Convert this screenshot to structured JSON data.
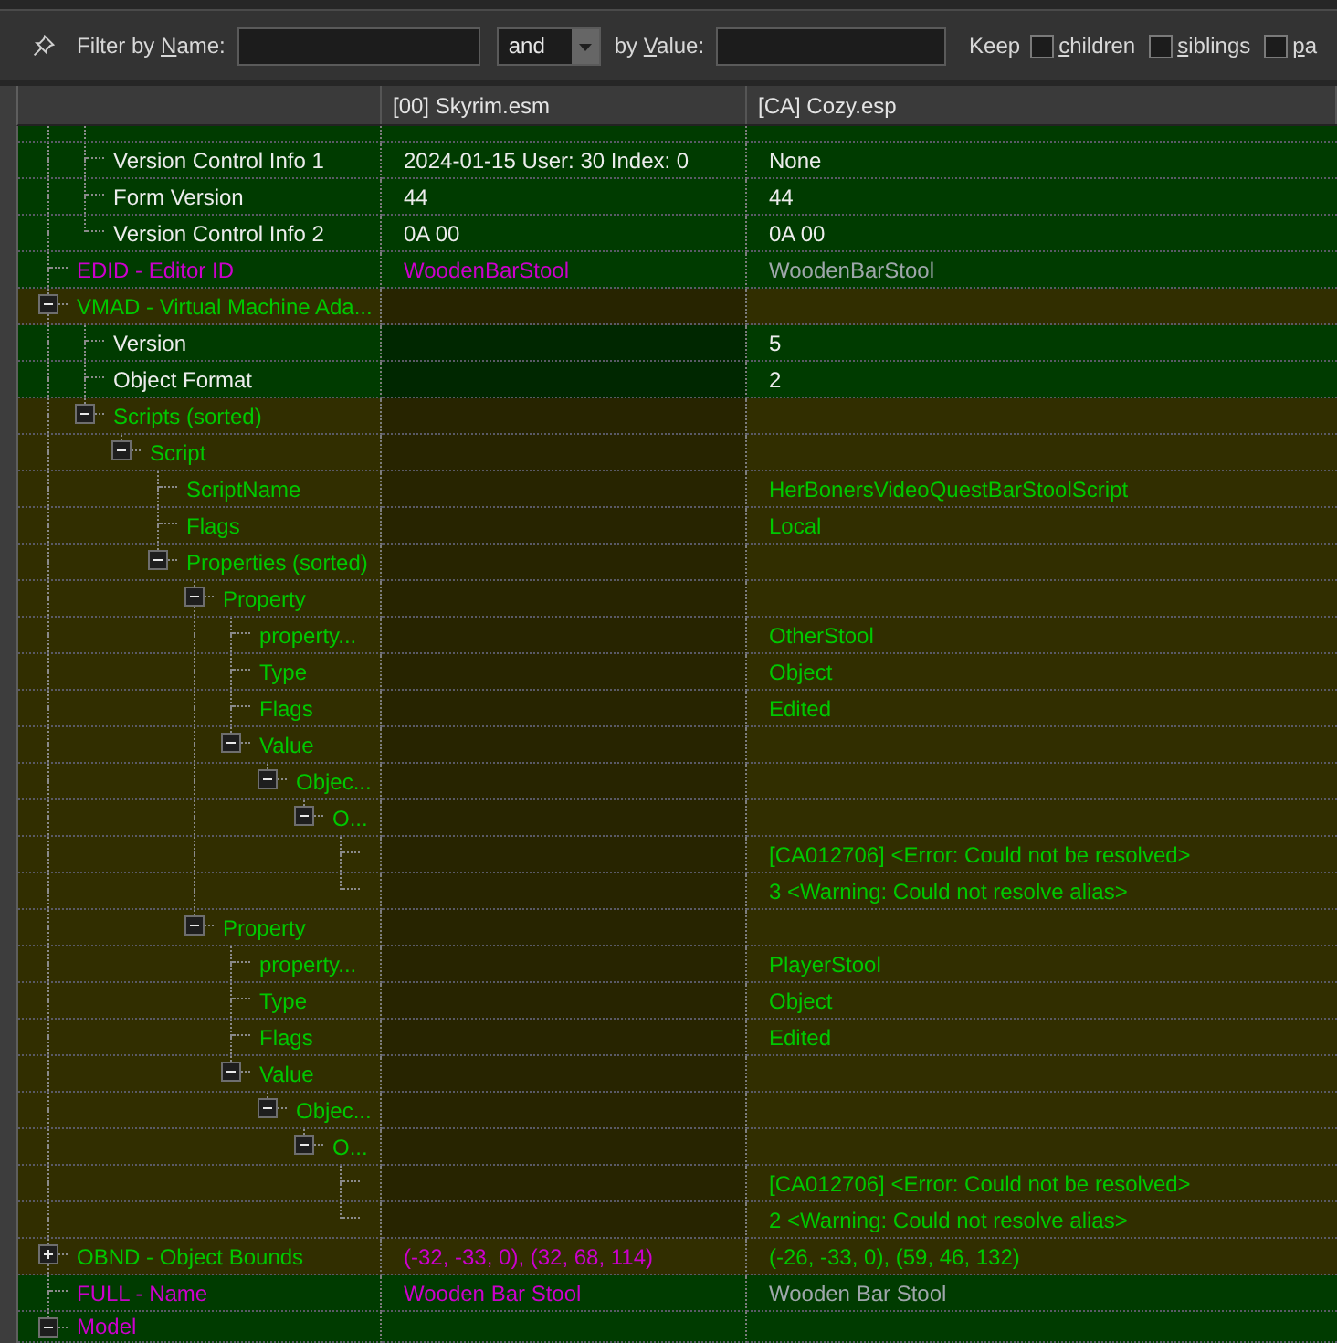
{
  "toolbar": {
    "name_filter": {
      "label": {
        "before": "Filter by ",
        "accel": "N",
        "after": "ame:"
      }
    },
    "operator": {
      "value": "and"
    },
    "value_filter": {
      "label": {
        "before": "by ",
        "accel": "V",
        "after": "alue:"
      }
    },
    "keep": {
      "label": "Keep",
      "options": [
        {
          "label": {
            "accel": "c",
            "after": "hildren"
          },
          "checked": false
        },
        {
          "label": {
            "accel": "s",
            "after": "iblings"
          },
          "checked": false
        },
        {
          "label": {
            "accel": "p",
            "after": "a"
          },
          "checked": false
        }
      ]
    }
  },
  "columns": [
    "[00] Skyrim.esm",
    "[CA] Cozy.esp"
  ],
  "tree": [
    {
      "children": [
        {
          "name": "Version Control Info 1",
          "color": "#ececec",
          "kind": "match",
          "cells": [
            {
              "defined": true,
              "text": "2024-01-15 User: 30 Index: 0",
              "color": "#ececec"
            },
            {
              "defined": true,
              "text": "None",
              "color": "#ececec"
            }
          ]
        },
        {
          "name": "Form Version",
          "color": "#ececec",
          "kind": "match",
          "cells": [
            {
              "defined": true,
              "text": "44",
              "color": "#ececec"
            },
            {
              "defined": true,
              "text": "44",
              "color": "#ececec"
            }
          ]
        },
        {
          "name": "Version Control Info 2",
          "color": "#ececec",
          "kind": "match",
          "cells": [
            {
              "defined": true,
              "text": "0A 00",
              "color": "#ececec"
            },
            {
              "defined": true,
              "text": "0A 00",
              "color": "#ececec"
            }
          ]
        }
      ]
    },
    {
      "name": "EDID - Editor ID",
      "color": "#cc00cc",
      "kind": "match",
      "cells": [
        {
          "defined": true,
          "text": "WoodenBarStool",
          "color": "#cc00cc"
        },
        {
          "defined": true,
          "text": "WoodenBarStool",
          "color": "#9fa7ab"
        }
      ]
    },
    {
      "name": "VMAD - Virtual Machine Ada...",
      "color": "#00c800",
      "kind": "override",
      "expanded": true,
      "cells": [
        {
          "defined": false
        },
        {
          "defined": true
        }
      ],
      "children": [
        {
          "name": "Version",
          "color": "#ececec",
          "kind": "match",
          "cells": [
            {
              "defined": false
            },
            {
              "defined": true,
              "text": "5",
              "color": "#ececec"
            }
          ]
        },
        {
          "name": "Object Format",
          "color": "#ececec",
          "kind": "match",
          "cells": [
            {
              "defined": false
            },
            {
              "defined": true,
              "text": "2",
              "color": "#ececec"
            }
          ]
        },
        {
          "name": "Scripts (sorted)",
          "color": "#00c800",
          "kind": "override",
          "expanded": true,
          "cells": [
            {
              "defined": false
            },
            {
              "defined": true
            }
          ],
          "children": [
            {
              "name": "Script",
              "color": "#00c800",
              "kind": "override",
              "expanded": true,
              "cells": [
                {
                  "defined": false
                },
                {
                  "defined": true
                }
              ],
              "children": [
                {
                  "name": "ScriptName",
                  "color": "#00c800",
                  "kind": "override",
                  "cells": [
                    {
                      "defined": false
                    },
                    {
                      "defined": true,
                      "text": "HerBonersVideoQuestBarStoolScript",
                      "color": "#00c800"
                    }
                  ]
                },
                {
                  "name": "Flags",
                  "color": "#00c800",
                  "kind": "override",
                  "cells": [
                    {
                      "defined": false
                    },
                    {
                      "defined": true,
                      "text": "Local",
                      "color": "#00c800"
                    }
                  ]
                },
                {
                  "name": "Properties (sorted)",
                  "color": "#00c800",
                  "kind": "override",
                  "expanded": true,
                  "cells": [
                    {
                      "defined": false
                    },
                    {
                      "defined": true
                    }
                  ],
                  "children": [
                    {
                      "name": "Property",
                      "color": "#00c800",
                      "kind": "override",
                      "expanded": true,
                      "cells": [
                        {
                          "defined": false
                        },
                        {
                          "defined": true
                        }
                      ],
                      "children": [
                        {
                          "name": "property...",
                          "color": "#00c800",
                          "kind": "override",
                          "cells": [
                            {
                              "defined": false
                            },
                            {
                              "defined": true,
                              "text": "OtherStool",
                              "color": "#00c800"
                            }
                          ]
                        },
                        {
                          "name": "Type",
                          "color": "#00c800",
                          "kind": "override",
                          "cells": [
                            {
                              "defined": false
                            },
                            {
                              "defined": true,
                              "text": "Object",
                              "color": "#00c800"
                            }
                          ]
                        },
                        {
                          "name": "Flags",
                          "color": "#00c800",
                          "kind": "override",
                          "cells": [
                            {
                              "defined": false
                            },
                            {
                              "defined": true,
                              "text": "Edited",
                              "color": "#00c800"
                            }
                          ]
                        },
                        {
                          "name": "Value",
                          "color": "#00c800",
                          "kind": "override",
                          "expanded": true,
                          "cells": [
                            {
                              "defined": false
                            },
                            {
                              "defined": true
                            }
                          ],
                          "children": [
                            {
                              "name": "Objec...",
                              "color": "#00c800",
                              "kind": "override",
                              "expanded": true,
                              "cells": [
                                {
                                  "defined": false
                                },
                                {
                                  "defined": true
                                }
                              ],
                              "children": [
                                {
                                  "name": "O...",
                                  "color": "#00c800",
                                  "kind": "override",
                                  "expanded": true,
                                  "cells": [
                                    {
                                      "defined": false
                                    },
                                    {
                                      "defined": true
                                    }
                                  ],
                                  "children": [
                                    {
                                      "kind": "override",
                                      "cells": [
                                        {
                                          "defined": false
                                        },
                                        {
                                          "defined": true,
                                          "text": "[CA012706] <Error: Could not be resolved>",
                                          "color": "#00c800"
                                        }
                                      ]
                                    },
                                    {
                                      "kind": "override",
                                      "cells": [
                                        {
                                          "defined": false
                                        },
                                        {
                                          "defined": true,
                                          "text": "3 <Warning: Could not resolve alias>",
                                          "color": "#00c800"
                                        }
                                      ]
                                    }
                                  ]
                                }
                              ]
                            }
                          ]
                        }
                      ]
                    },
                    {
                      "name": "Property",
                      "color": "#00c800",
                      "kind": "override",
                      "expanded": true,
                      "cells": [
                        {
                          "defined": false
                        },
                        {
                          "defined": true
                        }
                      ],
                      "children": [
                        {
                          "name": "property...",
                          "color": "#00c800",
                          "kind": "override",
                          "cells": [
                            {
                              "defined": false
                            },
                            {
                              "defined": true,
                              "text": "PlayerStool",
                              "color": "#00c800"
                            }
                          ]
                        },
                        {
                          "name": "Type",
                          "color": "#00c800",
                          "kind": "override",
                          "cells": [
                            {
                              "defined": false
                            },
                            {
                              "defined": true,
                              "text": "Object",
                              "color": "#00c800"
                            }
                          ]
                        },
                        {
                          "name": "Flags",
                          "color": "#00c800",
                          "kind": "override",
                          "cells": [
                            {
                              "defined": false
                            },
                            {
                              "defined": true,
                              "text": "Edited",
                              "color": "#00c800"
                            }
                          ]
                        },
                        {
                          "name": "Value",
                          "color": "#00c800",
                          "kind": "override",
                          "expanded": true,
                          "cells": [
                            {
                              "defined": false
                            },
                            {
                              "defined": true
                            }
                          ],
                          "children": [
                            {
                              "name": "Objec...",
                              "color": "#00c800",
                              "kind": "override",
                              "expanded": true,
                              "cells": [
                                {
                                  "defined": false
                                },
                                {
                                  "defined": true
                                }
                              ],
                              "children": [
                                {
                                  "name": "O...",
                                  "color": "#00c800",
                                  "kind": "override",
                                  "expanded": true,
                                  "cells": [
                                    {
                                      "defined": false
                                    },
                                    {
                                      "defined": true
                                    }
                                  ],
                                  "children": [
                                    {
                                      "kind": "override",
                                      "cells": [
                                        {
                                          "defined": false
                                        },
                                        {
                                          "defined": true,
                                          "text": "[CA012706] <Error: Could not be resolved>",
                                          "color": "#00c800"
                                        }
                                      ]
                                    },
                                    {
                                      "kind": "override",
                                      "cells": [
                                        {
                                          "defined": false
                                        },
                                        {
                                          "defined": true,
                                          "text": "2 <Warning: Could not resolve alias>",
                                          "color": "#00c800"
                                        }
                                      ]
                                    }
                                  ]
                                }
                              ]
                            }
                          ]
                        }
                      ]
                    }
                  ]
                }
              ]
            }
          ]
        }
      ]
    },
    {
      "name": "OBND - Object Bounds",
      "color": "#00c800",
      "kind": "override",
      "expanded": false,
      "cells": [
        {
          "defined": true,
          "text": "(-32, -33, 0), (32, 68, 114)",
          "color": "#cc00cc"
        },
        {
          "defined": true,
          "text": "(-26, -33, 0), (59, 46, 132)",
          "color": "#00c800"
        }
      ]
    },
    {
      "name": "FULL - Name",
      "color": "#cc00cc",
      "kind": "match",
      "cells": [
        {
          "defined": true,
          "text": "Wooden Bar Stool",
          "color": "#cc00cc"
        },
        {
          "defined": true,
          "text": "Wooden Bar Stool",
          "color": "#9fa7ab"
        }
      ]
    },
    {
      "name": "Model",
      "color": "#cc00cc",
      "kind": "match",
      "expanded": true,
      "cells": [
        {
          "defined": true
        },
        {
          "defined": true
        }
      ]
    }
  ]
}
